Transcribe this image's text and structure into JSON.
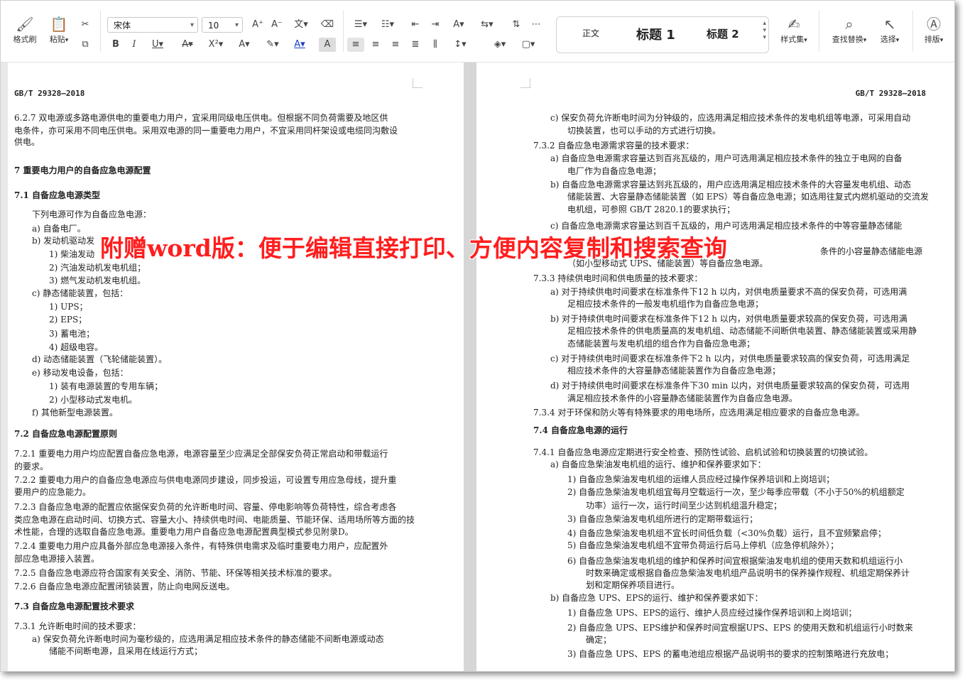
{
  "ribbon": {
    "format_painter": "格式刷",
    "paste": "粘贴",
    "font_name": "宋体",
    "font_size": "10",
    "styles": {
      "normal": "正文",
      "heading1": "标题 1",
      "heading2": "标题 2"
    },
    "style_set": "样式集",
    "find_replace": "查找替换",
    "select": "选择",
    "layout": "排版"
  },
  "watermark": "附赠word版：便于编辑直接打印、方便内容复制和搜索查询",
  "left_page": {
    "header": "GB/T  29328—2018",
    "lines": [
      "6.2.7  双电源或多路电源供电的重要电力用户，宜采用同级电压供电。但根据不同负荷需要及地区供",
      "电条件，亦可采用不同电压供电。采用双电源的同一重要电力用户，不宜采用同杆架设或电缆同沟敷设",
      "供电。",
      "7  重要电力用户的自备应急电源配置",
      "7.1  自备应急电源类型",
      "下列电源可作为自备应急电源：",
      "a)  自备电厂。",
      "b)  发动机驱动发",
      "1)   柴油发动",
      "2)   汽油发动机发电机组；",
      "3)   燃气发动机发电机组。",
      "c)  静态储能装置，包括：",
      "1)   UPS；",
      "2)   EPS；",
      "3)   蓄电池；",
      "4)   超级电容。",
      "d)  动态储能装置（飞轮储能装置）。",
      "e)  移动发电设备，包括：",
      "1)   装有电源装置的专用车辆；",
      "2)   小型移动式发电机。",
      "f)  其他新型电源装置。",
      "7.2  自备应急电源配置原则",
      "7.2.1  重要电力用户均应配置自备应急电源，电源容量至少应满足全部保安负荷正常启动和带载运行",
      "的要求。",
      "7.2.2  重要电力用户的自备应急电源应与供电电源同步建设，同步投运，可设置专用应急母线，提升重",
      "要用户的应急能力。",
      "7.2.3  自备应急电源的配置应依据保安负荷的允许断电时间、容量、停电影响等负荷特性，综合考虑各",
      "类应急电源在启动时间、切换方式、容量大小、持续供电时间、电能质量、节能环保、适用场所等方面的技",
      "术性能，合理的选取自备应急电源。重要电力用户自备应急电源配置典型模式参见附录D。",
      "7.2.4  重要电力用户应具备外部应急电源接入条件，有特殊供电需求及临时重要电力用户，应配置外",
      "部应急电源接入装置。",
      "7.2.5  自备应急电源应符合国家有关安全、消防、节能、环保等相关技术标准的要求。",
      "7.2.6  自备应急电源应配置闭锁装置，防止向电网反送电。",
      "7.3  自备应急电源配置技术要求",
      "7.3.1  允许断电时间的技术要求：",
      "a)  保安负荷允许断电时间为毫秒级的，应选用满足相应技术条件的静态储能不间断电源或动态",
      "储能不间断电源，且采用在线运行方式；"
    ]
  },
  "right_page": {
    "header": "GB/T  29328—2018",
    "lines": [
      "c)  保安负荷允许断电时间为分钟级的，应选用满足相应技术条件的发电机组等电源，可采用自动",
      "切换装置，也可以手动的方式进行切换。",
      "7.3.2  自备应急电源需求容量的技术要求：",
      "a)  自备应急电源需求容量达到百兆瓦级的，用户可选用满足相应技术条件的独立于电网的自备",
      "电厂作为自备应急电源；",
      "b)  自备应急电源需求容量达到兆瓦级的，用户应选用满足相应技术条件的大容量发电机组、动态",
      "储能装置、大容量静态储能装置（如 EPS）等自备应急电源；如选用往复式内燃机驱动的交流发",
      "电机组，可参照 GB/T  2820.1的要求执行；",
      "c)  自备应急电源需求容量达到百千瓦级的，用户可选用满足相应技术条件的中等容量静态储能",
      "条件的小容量静态储能电源",
      "（如小型移动式 UPS、储能装置）等自备应急电源。",
      "7.3.3  持续供电时间和供电质量的技术要求：",
      "a)  对于持续供电时间要求在标准条件下12 h 以内，对供电质量要求不高的保安负荷，可选用满",
      "足相应技术条件的一般发电机组作为自备应急电源；",
      "b)  对于持续供电时间要求在标准条件下12 h 以内，对供电质量要求较高的保安负荷，可选用满",
      "足相应技术条件的供电质量高的发电机组、动态储能不间断供电装置、静态储能装置或采用静",
      "态储能装置与发电机组的组合作为自备应急电源；",
      "c)  对于持续供电时间要求在标准条件下2 h 以内，对供电质量要求较高的保安负荷，可选用满足",
      "相应技术条件的大容量静态储能装置作为自备应急电源；",
      "d)  对于持续供电时间要求在标准条件下30  min 以内，对供电质量要求较高的保安负荷，可选用",
      "满足相应技术条件的小容量静态储能装置作为自备应急电源。",
      "7.3.4  对于环保和防火等有特殊要求的用电场所，应选用满足相应要求的自备应急电源。",
      "7.4  自备应急电源的运行",
      "7.4.1  自备应急电源应定期进行安全检查、预防性试验、启机试验和切换装置的切换试验。",
      "a)  自备应急柴油发电机组的运行、维护和保养要求如下：",
      "1)   自备应急柴油发电机组的运维人员应经过操作保养培训和上岗培训；",
      "2)   自备应急柴油发电机组宜每月空载运行一次，至少每季应带载（不小于50%的机组额定",
      "功率）运行一次，运行时间至少达到机组温升稳定；",
      "3)   自备应急柴油发电机组所进行的定期带载运行；",
      "4)   自备应急柴油发电机组不宜长时间低负载（<30%负载）运行，且不宜频繁启停；",
      "5)   自备应急柴油发电机组不宜带负荷运行后马上停机（应急停机除外）；",
      "6)   自备应急柴油发电机组的维护和保养时间宜根据柴油发电机组的使用天数和机组运行小",
      "时数来确定或根据自备应急柴油发电机组产品说明书的保养操作规程、机组定期保养计",
      "划和定期保养项目进行。",
      "b)  自备应急 UPS、EPS的运行、维护和保养要求如下：",
      "1)   自备应急 UPS、EPS的运行、维护人员应经过操作保养培训和上岗培训；",
      "2)   自备应急 UPS、EPS维护和保养时间宜根据UPS、EPS 的使用天数和机组运行小时数来",
      "确定；",
      "3)   自备应急 UPS、EPS 的蓄电池组应根据产品说明书的要求的控制策略进行充放电；"
    ]
  }
}
